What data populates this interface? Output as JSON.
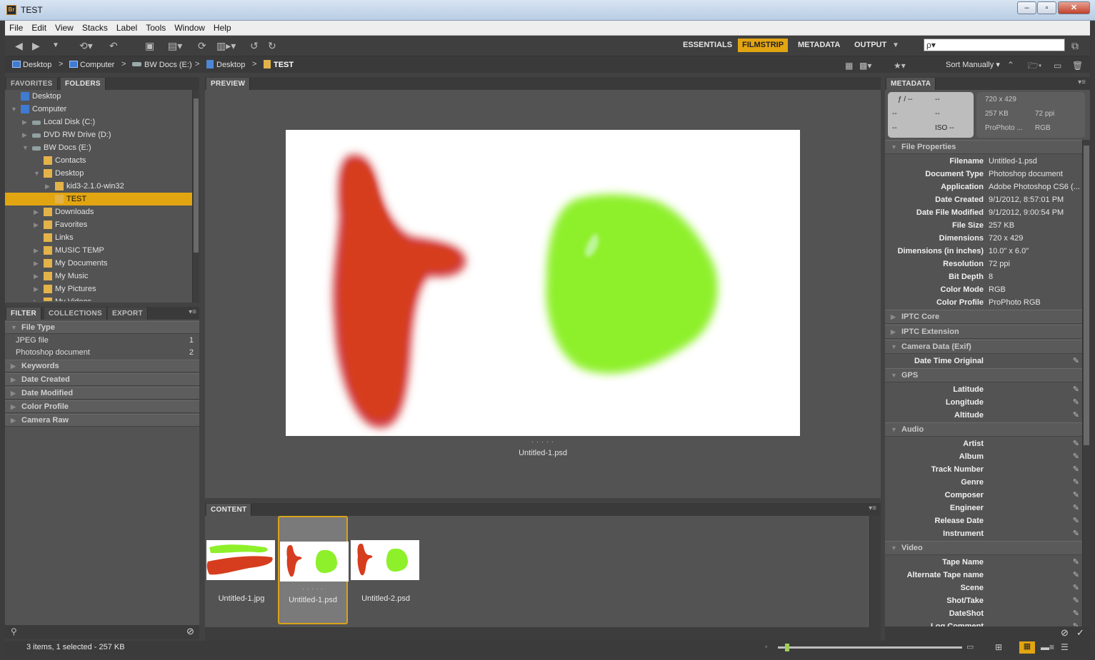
{
  "window": {
    "title": "TEST",
    "app_icon": "Br"
  },
  "menu": [
    "File",
    "Edit",
    "View",
    "Stacks",
    "Label",
    "Tools",
    "Window",
    "Help"
  ],
  "workspaces": [
    "ESSENTIALS",
    "FILMSTRIP",
    "METADATA",
    "OUTPUT"
  ],
  "active_workspace": "FILMSTRIP",
  "search": {
    "placeholder": "ρ▾"
  },
  "sort": {
    "label": "Sort Manually"
  },
  "breadcrumb": [
    "Desktop",
    "Computer",
    "BW Docs (E:)",
    "Desktop",
    "TEST"
  ],
  "left_tabs": {
    "favorites": "FAVORITES",
    "folders": "FOLDERS"
  },
  "folder_tree": [
    {
      "label": "Desktop",
      "icon": "monitor"
    },
    {
      "label": "Computer",
      "icon": "computer"
    },
    {
      "label": "Local Disk (C:)",
      "icon": "drive"
    },
    {
      "label": "DVD RW Drive (D:)",
      "icon": "dvd-drive"
    },
    {
      "label": "BW Docs (E:)",
      "icon": "drive"
    },
    {
      "label": "Contacts",
      "icon": "folder"
    },
    {
      "label": "Desktop",
      "icon": "folder"
    },
    {
      "label": "kid3-2.1.0-win32",
      "icon": "folder"
    },
    {
      "label": "TEST",
      "icon": "folder",
      "selected": true
    },
    {
      "label": "Downloads",
      "icon": "folder"
    },
    {
      "label": "Favorites",
      "icon": "folder"
    },
    {
      "label": "Links",
      "icon": "folder"
    },
    {
      "label": "MUSIC TEMP",
      "icon": "folder"
    },
    {
      "label": "My Documents",
      "icon": "folder"
    },
    {
      "label": "My Music",
      "icon": "folder"
    },
    {
      "label": "My Pictures",
      "icon": "folder"
    },
    {
      "label": "My Videos",
      "icon": "folder"
    }
  ],
  "filter_tabs": {
    "filter": "FILTER",
    "collections": "COLLECTIONS",
    "export": "EXPORT"
  },
  "filter": {
    "file_type": "File Type",
    "rows": [
      {
        "label": "JPEG file",
        "count": "1"
      },
      {
        "label": "Photoshop document",
        "count": "2"
      }
    ],
    "sections": [
      "Keywords",
      "Date Created",
      "Date Modified",
      "Color Profile",
      "Camera Raw"
    ]
  },
  "preview": {
    "tab": "PREVIEW",
    "filename": "Untitled-1.psd",
    "dots": ". . . . ."
  },
  "content": {
    "tab": "CONTENT",
    "items": [
      {
        "name": "Untitled-1.jpg"
      },
      {
        "name": "Untitled-1.psd",
        "selected": true,
        "dots": ". . . . ."
      },
      {
        "name": "Untitled-2.psd"
      }
    ]
  },
  "metadata_tab": "METADATA",
  "metadata_summary": {
    "f": "ƒ / --",
    "exp": "--",
    "r2a": "--",
    "r2b": "--",
    "r3a": "--",
    "iso": "ISO --",
    "dims": "720 x 429",
    "size": "257 KB",
    "ppi": "72 ppi",
    "profile": "ProPhoto ...",
    "mode": "RGB"
  },
  "file_properties": {
    "title": "File Properties",
    "rows": [
      {
        "k": "Filename",
        "v": "Untitled-1.psd"
      },
      {
        "k": "Document Type",
        "v": "Photoshop document"
      },
      {
        "k": "Application",
        "v": "Adobe Photoshop CS6 (..."
      },
      {
        "k": "Date Created",
        "v": "9/1/2012, 8:57:01 PM"
      },
      {
        "k": "Date File Modified",
        "v": "9/1/2012, 9:00:54 PM"
      },
      {
        "k": "File Size",
        "v": "257 KB"
      },
      {
        "k": "Dimensions",
        "v": "720 x 429"
      },
      {
        "k": "Dimensions (in inches)",
        "v": "10.0\" x 6.0\""
      },
      {
        "k": "Resolution",
        "v": "72 ppi"
      },
      {
        "k": "Bit Depth",
        "v": "8"
      },
      {
        "k": "Color Mode",
        "v": "RGB"
      },
      {
        "k": "Color Profile",
        "v": "ProPhoto RGB"
      }
    ]
  },
  "meta_sections": {
    "iptc_core": "IPTC Core",
    "iptc_ext": "IPTC Extension",
    "camera": "Camera Data (Exif)",
    "camera_rows": [
      "Date Time Original"
    ],
    "gps": "GPS",
    "gps_rows": [
      "Latitude",
      "Longitude",
      "Altitude"
    ],
    "audio": "Audio",
    "audio_rows": [
      "Artist",
      "Album",
      "Track Number",
      "Genre",
      "Composer",
      "Engineer",
      "Release Date",
      "Instrument"
    ],
    "video": "Video",
    "video_rows": [
      "Tape Name",
      "Alternate Tape name",
      "Scene",
      "Shot/Take",
      "DateShot",
      "Log Comment"
    ]
  },
  "status": {
    "text": "3 items, 1 selected - 257 KB",
    "thumb_size": 0.04
  },
  "colors": {
    "accent": "#e2a512",
    "red_paint": "#d63d1e",
    "green_paint": "#8ef02a"
  }
}
